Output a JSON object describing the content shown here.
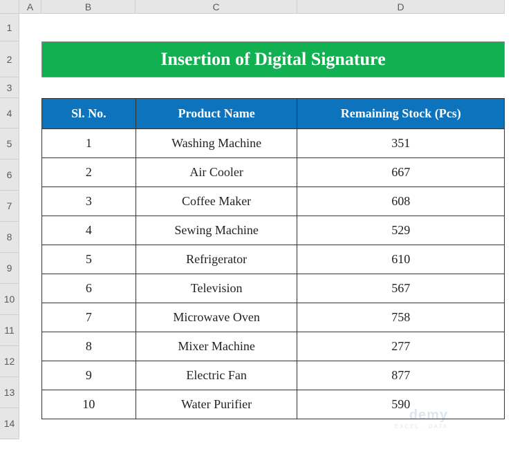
{
  "columns": [
    "A",
    "B",
    "C",
    "D"
  ],
  "rows": [
    "1",
    "2",
    "3",
    "4",
    "5",
    "6",
    "7",
    "8",
    "9",
    "10",
    "11",
    "12",
    "13",
    "14"
  ],
  "title": "Insertion of Digital Signature",
  "headers": {
    "sl": "Sl. No.",
    "product": "Product Name",
    "stock": "Remaining Stock (Pcs)"
  },
  "data": [
    {
      "sl": "1",
      "product": "Washing Machine",
      "stock": "351"
    },
    {
      "sl": "2",
      "product": "Air Cooler",
      "stock": "667"
    },
    {
      "sl": "3",
      "product": "Coffee Maker",
      "stock": "608"
    },
    {
      "sl": "4",
      "product": "Sewing Machine",
      "stock": "529"
    },
    {
      "sl": "5",
      "product": "Refrigerator",
      "stock": "610"
    },
    {
      "sl": "6",
      "product": "Television",
      "stock": "567"
    },
    {
      "sl": "7",
      "product": "Microwave Oven",
      "stock": "758"
    },
    {
      "sl": "8",
      "product": "Mixer Machine",
      "stock": "277"
    },
    {
      "sl": "9",
      "product": "Electric Fan",
      "stock": "877"
    },
    {
      "sl": "10",
      "product": "Water Purifier",
      "stock": "590"
    }
  ],
  "watermark": {
    "line1": "demy",
    "line2": "EXCEL · DATA"
  }
}
